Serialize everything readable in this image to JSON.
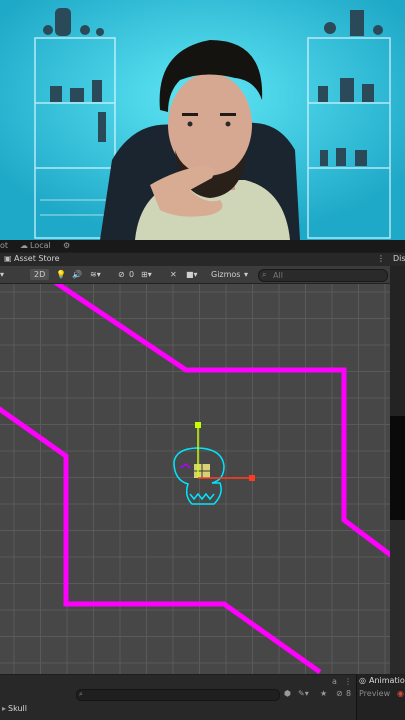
{
  "editor": {
    "top_tabs": [
      "ot",
      "Local"
    ],
    "tab_title": "Asset Store",
    "side_tab_label": "Dis",
    "scene_toolbar": {
      "mode_2d": "2D",
      "visibility_count": "0",
      "gizmos_label": "Gizmos",
      "search_placeholder": "All"
    },
    "hierarchy": {
      "root_item": "Skull",
      "layers_count": "8"
    },
    "animation_panel": {
      "title": "Animatio",
      "preview_label": "Preview"
    }
  },
  "colors": {
    "path_line": "#ff00ff",
    "sprite_outline": "#00e5ff",
    "gizmo_y": "#c8ff00",
    "gizmo_x": "#ff3b1f"
  }
}
